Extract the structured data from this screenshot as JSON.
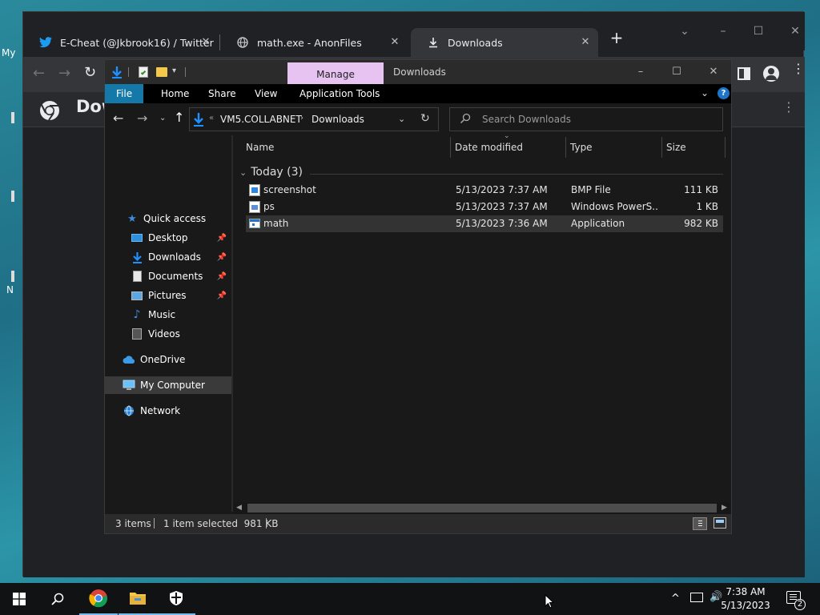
{
  "desktop": {
    "left_fragments": [
      "My",
      "N"
    ]
  },
  "chrome": {
    "tabs": [
      {
        "title": "E-Cheat (@Jkbrook16) / Twitter",
        "icon": "twitter-icon"
      },
      {
        "title": "math.exe - AnonFiles",
        "icon": "globe-icon"
      },
      {
        "title": "Downloads",
        "icon": "download-icon"
      }
    ],
    "page_header_title": "Dow"
  },
  "explorer": {
    "title": "Downloads",
    "manage_tab": "Manage",
    "ribbon_tabs": [
      "File",
      "Home",
      "Share",
      "View",
      "Application Tools"
    ],
    "address": {
      "root": "VM5.COLLABNET",
      "current": "Downloads"
    },
    "search_placeholder": "Search Downloads",
    "nav": [
      {
        "label": "Quick access",
        "icon": "star-icon"
      },
      {
        "label": "Desktop",
        "icon": "desktop-folder-icon",
        "pinned": true
      },
      {
        "label": "Downloads",
        "icon": "downloads-folder-icon",
        "pinned": true
      },
      {
        "label": "Documents",
        "icon": "documents-folder-icon",
        "pinned": true
      },
      {
        "label": "Pictures",
        "icon": "pictures-folder-icon",
        "pinned": true
      },
      {
        "label": "Music",
        "icon": "music-icon"
      },
      {
        "label": "Videos",
        "icon": "videos-icon"
      },
      {
        "label": "OneDrive",
        "icon": "cloud-icon"
      },
      {
        "label": "My Computer",
        "icon": "computer-icon",
        "selected": true
      },
      {
        "label": "Network",
        "icon": "network-icon"
      }
    ],
    "columns": [
      "Name",
      "Date modified",
      "Type",
      "Size"
    ],
    "group": "Today (3)",
    "files": [
      {
        "name": "screenshot",
        "date": "5/13/2023 7:37 AM",
        "type": "BMP File",
        "size": "111 KB"
      },
      {
        "name": "ps",
        "date": "5/13/2023 7:37 AM",
        "type": "Windows PowerS...",
        "size": "1 KB"
      },
      {
        "name": "math",
        "date": "5/13/2023 7:36 AM",
        "type": "Application",
        "size": "982 KB",
        "selected": true
      }
    ],
    "status": {
      "items": "3 items",
      "selected": "1 item selected  981 KB"
    }
  },
  "taskbar": {
    "time": "7:38 AM",
    "date": "5/13/2023",
    "notification_count": "2"
  },
  "colors": {
    "manage_tab": "#e6c3f0",
    "file_tab": "#1478a8",
    "accent": "#76b9ed"
  }
}
